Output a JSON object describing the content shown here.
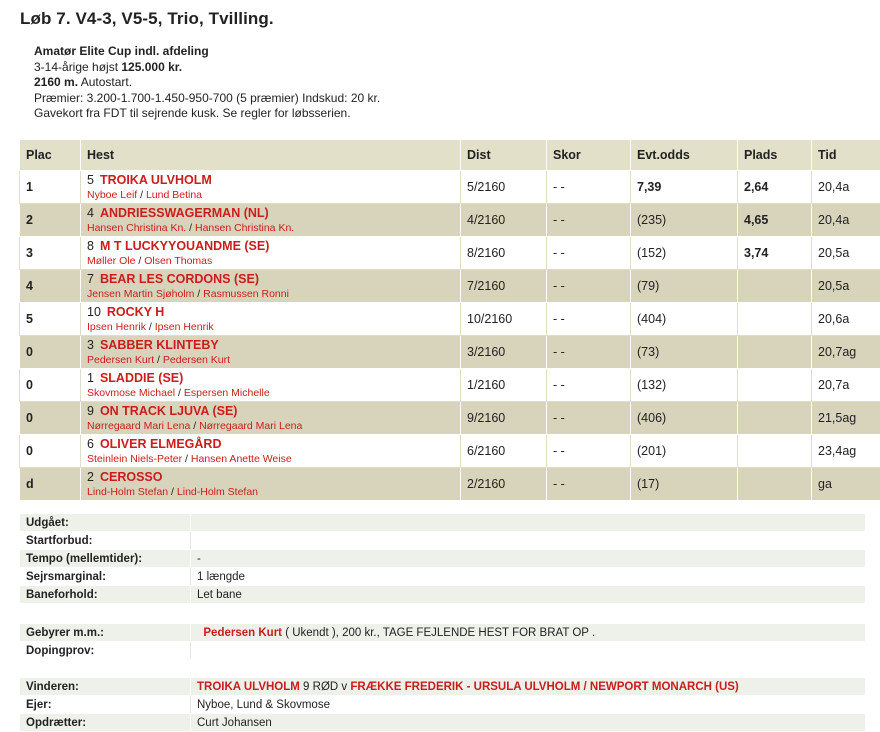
{
  "race": {
    "title": "Løb 7. V4-3, V5-5, Trio, Tvilling.",
    "line1": "Amatør Elite Cup indl. afdeling",
    "line2_pre": "3-14-årige højst ",
    "line2_bold": "125.000 kr.",
    "line3_bold": "2160 m.",
    "line3_rest": " Autostart.",
    "line4": "Præmier: 3.200-1.700-1.450-950-700 (5 præmier) Indskud: 20 kr.",
    "line5": "Gavekort fra FDT til sejrende kusk. Se regler for løbsserien."
  },
  "columns": {
    "plac": "Plac",
    "hest": "Hest",
    "dist": "Dist",
    "skor": "Skor",
    "odds": "Evt.odds",
    "plads": "Plads",
    "tid": "Tid"
  },
  "rows": [
    {
      "plac": "1",
      "num": "5",
      "name": "TROIKA ULVHOLM",
      "driver": "Nyboe Leif",
      "trainer": "Lund Betina",
      "dist": "5/2160",
      "skor": "- -",
      "odds": "7,39",
      "plads": "2,64",
      "tid": "20,4a"
    },
    {
      "plac": "2",
      "num": "4",
      "name": "ANDRIESSWAGERMAN (NL)",
      "driver": "Hansen Christina Kn.",
      "trainer": "Hansen Christina Kn.",
      "dist": "4/2160",
      "skor": "- -",
      "odds": "(235)",
      "plads": "4,65",
      "tid": "20,4a"
    },
    {
      "plac": "3",
      "num": "8",
      "name": "M T LUCKYYOUANDME (SE)",
      "driver": "Møller Ole",
      "trainer": "Olsen Thomas",
      "dist": "8/2160",
      "skor": "- -",
      "odds": "(152)",
      "plads": "3,74",
      "tid": "20,5a"
    },
    {
      "plac": "4",
      "num": "7",
      "name": "BEAR LES CORDONS (SE)",
      "driver": "Jensen Martin Sjøholm",
      "trainer": "Rasmussen Ronni",
      "dist": "7/2160",
      "skor": "- -",
      "odds": "(79)",
      "plads": "",
      "tid": "20,5a"
    },
    {
      "plac": "5",
      "num": "10",
      "name": "ROCKY H",
      "driver": "Ipsen Henrik",
      "trainer": "Ipsen Henrik",
      "dist": "10/2160",
      "skor": "- -",
      "odds": "(404)",
      "plads": "",
      "tid": "20,6a"
    },
    {
      "plac": "0",
      "num": "3",
      "name": "SABBER KLINTEBY",
      "driver": "Pedersen Kurt",
      "trainer": "Pedersen Kurt",
      "dist": "3/2160",
      "skor": "- -",
      "odds": "(73)",
      "plads": "",
      "tid": "20,7ag"
    },
    {
      "plac": "0",
      "num": "1",
      "name": "SLADDIE (SE)",
      "driver": "Skovmose Michael",
      "trainer": "Espersen Michelle",
      "dist": "1/2160",
      "skor": "- -",
      "odds": "(132)",
      "plads": "",
      "tid": "20,7a"
    },
    {
      "plac": "0",
      "num": "9",
      "name": "ON TRACK LJUVA (SE)",
      "driver": "Nørregaard Mari Lena",
      "trainer": "Nørregaard Mari Lena",
      "dist": "9/2160",
      "skor": "- -",
      "odds": "(406)",
      "plads": "",
      "tid": "21,5ag"
    },
    {
      "plac": "0",
      "num": "6",
      "name": "OLIVER ELMEGÅRD",
      "driver": "Steinlein Niels-Peter",
      "trainer": "Hansen Anette Weise",
      "dist": "6/2160",
      "skor": "- -",
      "odds": "(201)",
      "plads": "",
      "tid": "23,4ag"
    },
    {
      "plac": "d",
      "num": "2",
      "name": "CEROSSO",
      "driver": "Lind-Holm Stefan",
      "trainer": "Lind-Holm Stefan",
      "dist": "2/2160",
      "skor": "- -",
      "odds": "(17)",
      "plads": "",
      "tid": "ga"
    }
  ],
  "meta": {
    "udgaet_label": "Udgået:",
    "udgaet_value": "",
    "startforbud_label": "Startforbud:",
    "startforbud_value": "",
    "tempo_label": "Tempo (mellemtider):",
    "tempo_value": "-",
    "sejr_label": "Sejrsmarginal:",
    "sejr_value": "1 længde",
    "bane_label": "Baneforhold:",
    "bane_value": "Let bane"
  },
  "fees": {
    "gebyr_label": "Gebyrer m.m.:",
    "gebyr_name": "Pedersen Kurt",
    "gebyr_rest": " ( Ukendt ), 200 kr., TAGE FEJLENDE HEST FOR BRAT OP .",
    "doping_label": "Dopingprov:",
    "doping_value": ""
  },
  "winner": {
    "vinder_label": "Vinderen:",
    "vinder_name": "TROIKA ULVHOLM",
    "vinder_mid": " 9 RØD v ",
    "vinder_pedigree": "FRÆKKE FREDERIK - URSULA ULVHOLM / NEWPORT MONARCH (US)",
    "ejer_label": "Ejer:",
    "ejer_value": "Nyboe, Lund & Skovmose",
    "opdraetter_label": "Opdrætter:",
    "opdraetter_value": "Curt Johansen"
  }
}
